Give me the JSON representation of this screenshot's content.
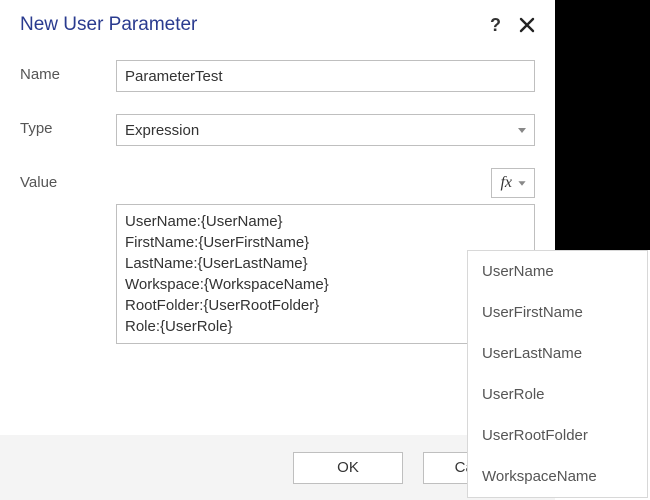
{
  "dialog": {
    "title": "New User Parameter"
  },
  "form": {
    "name_label": "Name",
    "name_value": "ParameterTest",
    "type_label": "Type",
    "type_value": "Expression",
    "value_label": "Value",
    "fx_label": "fx",
    "value_text": "UserName:{UserName}\nFirstName:{UserFirstName}\nLastName:{UserLastName}\nWorkspace:{WorkspaceName}\nRootFolder:{UserRootFolder}\nRole:{UserRole}"
  },
  "footer": {
    "ok": "OK",
    "cancel": "Cancel"
  },
  "dropdown": {
    "items": [
      "UserName",
      "UserFirstName",
      "UserLastName",
      "UserRole",
      "UserRootFolder",
      "WorkspaceName"
    ]
  }
}
